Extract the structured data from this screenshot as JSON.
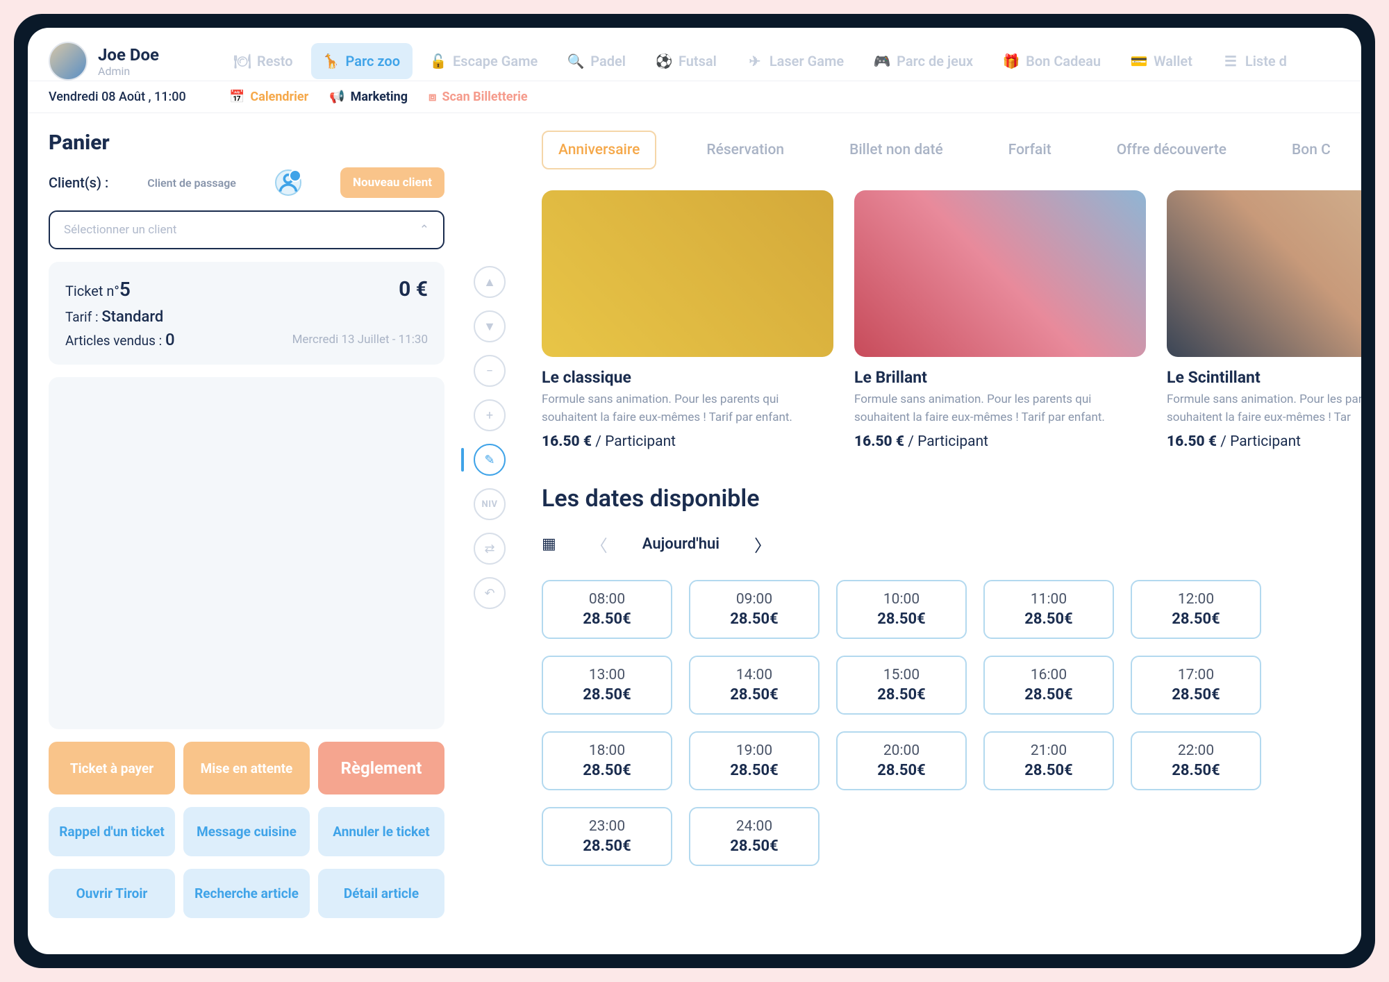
{
  "user": {
    "name": "Joe Doe",
    "role": "Admin"
  },
  "datetime": "Vendredi 08 Août , 11:00",
  "topTabs": [
    {
      "label": "Resto",
      "icon": "resto-icon"
    },
    {
      "label": "Parc zoo",
      "icon": "zoo-icon",
      "active": true
    },
    {
      "label": "Escape Game",
      "icon": "escape-icon"
    },
    {
      "label": "Padel",
      "icon": "padel-icon"
    },
    {
      "label": "Futsal",
      "icon": "futsal-icon"
    },
    {
      "label": "Laser Game",
      "icon": "laser-icon"
    },
    {
      "label": "Parc de jeux",
      "icon": "playground-icon"
    },
    {
      "label": "Bon Cadeau",
      "icon": "gift-icon"
    },
    {
      "label": "Wallet",
      "icon": "wallet-icon"
    },
    {
      "label": "Liste d",
      "icon": "list-icon"
    }
  ],
  "subTabs": {
    "calendrier": "Calendrier",
    "marketing": "Marketing",
    "scan": "Scan Billetterie"
  },
  "panier": {
    "title": "Panier",
    "clientLabel": "Client(s) :",
    "clientPassage": "Client de passage",
    "newClientBtn": "Nouveau client",
    "selectPlaceholder": "Sélectionner un client",
    "ticketPrefix": "Ticket n°",
    "ticketNum": "5",
    "ticketPrice": "0 €",
    "tarifLabel": "Tarif : ",
    "tarif": "Standard",
    "articlesLabel": "Articles vendus : ",
    "articlesCount": "0",
    "ticketDate": "Mercredi 13 Juillet - 11:30"
  },
  "actions": {
    "payer": "Ticket à payer",
    "attente": "Mise en attente",
    "reglement": "Règlement",
    "rappel": "Rappel d'un ticket",
    "message": "Message cuisine",
    "annuler": "Annuler le ticket",
    "tiroir": "Ouvrir Tiroir",
    "recherche": "Recherche article",
    "detail": "Détail article"
  },
  "vcol": {
    "niv": "NIV"
  },
  "offerTabs": [
    {
      "label": "Anniversaire",
      "active": true
    },
    {
      "label": "Réservation"
    },
    {
      "label": "Billet non daté"
    },
    {
      "label": "Forfait"
    },
    {
      "label": "Offre découverte"
    },
    {
      "label": "Bon C"
    }
  ],
  "cards": [
    {
      "title": "Le classique",
      "desc": "Formule sans animation. Pour les parents qui souhaitent la faire eux-mêmes ! Tarif par enfant.",
      "price": "16.50 €",
      "unit": " / Participant",
      "img": "ci1"
    },
    {
      "title": "Le Brillant",
      "desc": "Formule sans animation. Pour les parents qui souhaitent la faire eux-mêmes ! Tarif par enfant.",
      "price": "16.50 €",
      "unit": " / Participant",
      "img": "ci2"
    },
    {
      "title": "Le Scintillant",
      "desc": "Formule sans animation. Pour les parents qui souhaitent la faire eux-mêmes ! Tar",
      "price": "16.50 €",
      "unit": " / Participant",
      "img": "ci3"
    }
  ],
  "datesTitle": "Les dates disponible",
  "dateNav": {
    "today": "Aujourd'hui"
  },
  "slots": [
    {
      "time": "08:00",
      "price": "28.50€"
    },
    {
      "time": "09:00",
      "price": "28.50€"
    },
    {
      "time": "10:00",
      "price": "28.50€"
    },
    {
      "time": "11:00",
      "price": "28.50€"
    },
    {
      "time": "12:00",
      "price": "28.50€"
    },
    {
      "time": "13:00",
      "price": "28.50€"
    },
    {
      "time": "14:00",
      "price": "28.50€"
    },
    {
      "time": "15:00",
      "price": "28.50€"
    },
    {
      "time": "16:00",
      "price": "28.50€"
    },
    {
      "time": "17:00",
      "price": "28.50€"
    },
    {
      "time": "18:00",
      "price": "28.50€"
    },
    {
      "time": "19:00",
      "price": "28.50€"
    },
    {
      "time": "20:00",
      "price": "28.50€"
    },
    {
      "time": "21:00",
      "price": "28.50€"
    },
    {
      "time": "22:00",
      "price": "28.50€"
    },
    {
      "time": "23:00",
      "price": "28.50€"
    },
    {
      "time": "24:00",
      "price": "28.50€"
    }
  ]
}
